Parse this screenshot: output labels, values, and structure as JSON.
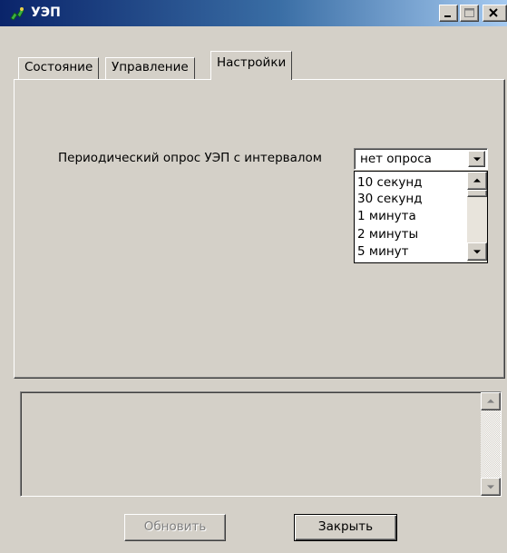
{
  "window": {
    "title": "УЭП",
    "controls": {
      "minimize": "_",
      "maximize": "□",
      "close": "×"
    }
  },
  "tabs": [
    {
      "label": "Состояние",
      "active": false
    },
    {
      "label": "Управление",
      "active": false
    },
    {
      "label": "Настройки",
      "active": true
    }
  ],
  "settings": {
    "poll_label": "Периодический опрос УЭП с интервалом",
    "poll_value": "нет опроса",
    "poll_options": [
      "10 секунд",
      "30 секунд",
      "1 минута",
      "2 минуты",
      "5 минут"
    ]
  },
  "buttons": {
    "refresh": "Обновить",
    "refresh_enabled": false,
    "close": "Закрыть"
  },
  "colors": {
    "face": "#d4d0c8",
    "title_start": "#0a246a",
    "title_end": "#a6caf0"
  },
  "icons": {
    "app": "uep-app-icon",
    "dropdown": "chevron-down-icon",
    "scroll_up": "scroll-up-arrow-icon",
    "scroll_down": "scroll-down-arrow-icon"
  }
}
